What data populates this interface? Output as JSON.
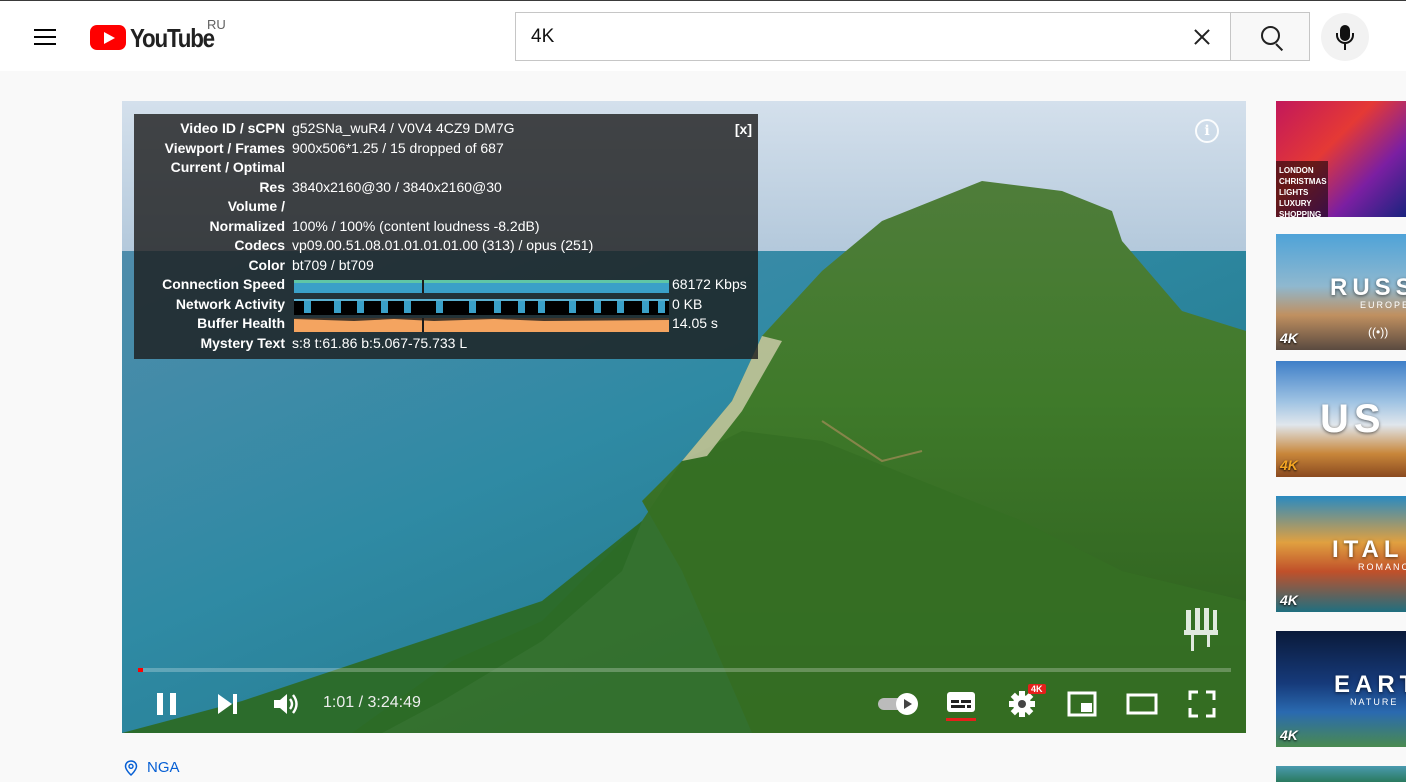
{
  "header": {
    "logo_text": "YouTube",
    "region": "RU",
    "search_value": "4K",
    "icons": {
      "menu": "hamburger-menu-icon",
      "clear": "close-icon",
      "search": "search-icon",
      "mic": "microphone-icon"
    }
  },
  "player": {
    "stats": {
      "close_label": "[x]",
      "rows": [
        {
          "key": "Video ID / sCPN",
          "value": "g52SNa_wuR4 / V0V4 4CZ9 DM7G"
        },
        {
          "key": "Viewport / Frames",
          "value": "900x506*1.25 / 15 dropped of 687"
        },
        {
          "key": "Current / Optimal",
          "value": ""
        },
        {
          "key": "Res",
          "value": "3840x2160@30 / 3840x2160@30"
        },
        {
          "key": "Volume /",
          "value": ""
        },
        {
          "key": "Normalized",
          "value": "100% / 100% (content loudness -8.2dB)"
        },
        {
          "key": "Codecs",
          "value": "vp09.00.51.08.01.01.01.01.00 (313) / opus (251)"
        },
        {
          "key": "Color",
          "value": "bt709 / bt709"
        },
        {
          "key": "Connection Speed",
          "value": "68172 Kbps"
        },
        {
          "key": "Network Activity",
          "value": "0 KB"
        },
        {
          "key": "Buffer Health",
          "value": "14.05 s"
        },
        {
          "key": "Mystery Text",
          "value": "s:8 t:61.86 b:5.067-75.733 L"
        }
      ]
    },
    "time": "1:01 / 3:24:49",
    "progress_fraction": 0.005,
    "quality_badge": "4K",
    "info_glyph": "i",
    "colors": {
      "progress": "#ff0000",
      "buffer_health": "#f4a460",
      "connection_speed": "#3aa0c8",
      "subtitle_active": "#e5201b"
    }
  },
  "sidebar": {
    "thumbs": [
      {
        "title": "",
        "sub": "",
        "tag": "",
        "lines": [
          "LONDON",
          "CHRISTMAS",
          "LIGHTS",
          "LUXURY",
          "SHOPPING"
        ]
      },
      {
        "title": "RUSS",
        "sub": "EUROPE",
        "tag": "4K",
        "live": "((•))"
      },
      {
        "title": "US",
        "sub": "",
        "tag": "4K"
      },
      {
        "title": "ITAL",
        "sub": "ROMANCE",
        "tag": "4K"
      },
      {
        "title": "EART",
        "sub": "NATURE",
        "tag": "4K"
      }
    ]
  },
  "location": {
    "label": "NGA"
  }
}
